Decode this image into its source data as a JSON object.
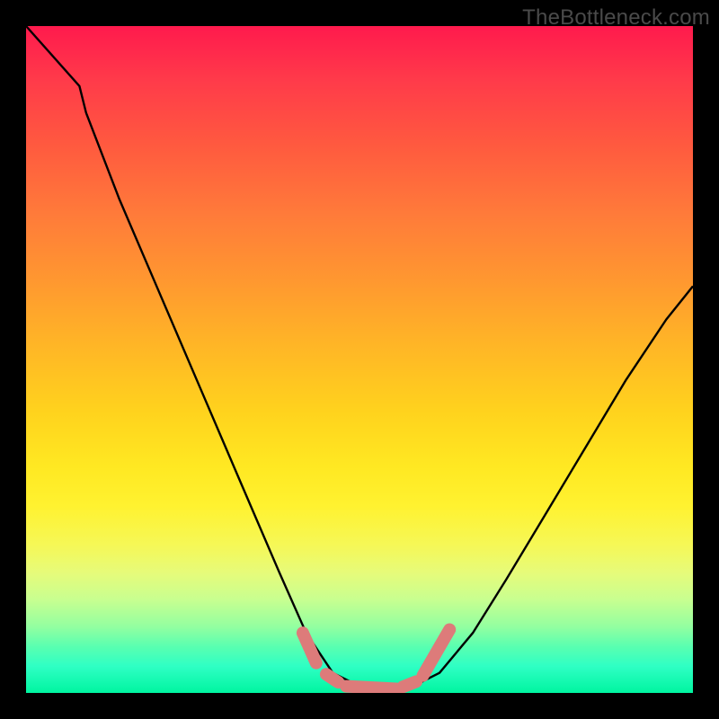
{
  "watermark": "TheBottleneck.com",
  "chart_data": {
    "type": "line",
    "title": "",
    "xlabel": "",
    "ylabel": "",
    "xlim": [
      0,
      100
    ],
    "ylim": [
      0,
      100
    ],
    "curve_comment": "Black V-shaped curve — approximate (x,y) points in percent of plot area, y measured from bottom.",
    "curve": [
      [
        0,
        100
      ],
      [
        8,
        91
      ],
      [
        9,
        87
      ],
      [
        14,
        74
      ],
      [
        20,
        60
      ],
      [
        26,
        46
      ],
      [
        32,
        32
      ],
      [
        38,
        18
      ],
      [
        42,
        9
      ],
      [
        46,
        3
      ],
      [
        50,
        1
      ],
      [
        52,
        0.5
      ],
      [
        55,
        0.5
      ],
      [
        58,
        1
      ],
      [
        62,
        3
      ],
      [
        67,
        9
      ],
      [
        72,
        17
      ],
      [
        78,
        27
      ],
      [
        84,
        37
      ],
      [
        90,
        47
      ],
      [
        96,
        56
      ],
      [
        100,
        61
      ]
    ],
    "markers_comment": "Pink rounded segments near the trough.",
    "markers": [
      {
        "x1": 41.5,
        "y1": 9.0,
        "x2": 43.5,
        "y2": 4.5
      },
      {
        "x1": 45.0,
        "y1": 2.8,
        "x2": 46.8,
        "y2": 1.6
      },
      {
        "x1": 48.0,
        "y1": 1.0,
        "x2": 55.5,
        "y2": 0.6
      },
      {
        "x1": 56.5,
        "y1": 0.9,
        "x2": 58.5,
        "y2": 1.7
      },
      {
        "x1": 59.5,
        "y1": 2.6,
        "x2": 63.5,
        "y2": 9.5
      }
    ],
    "colors": {
      "frame": "#000000",
      "curve": "#000000",
      "marker": "#dd7b7a",
      "gradient_top": "#ff1a4d",
      "gradient_bottom": "#00f5a0"
    }
  }
}
